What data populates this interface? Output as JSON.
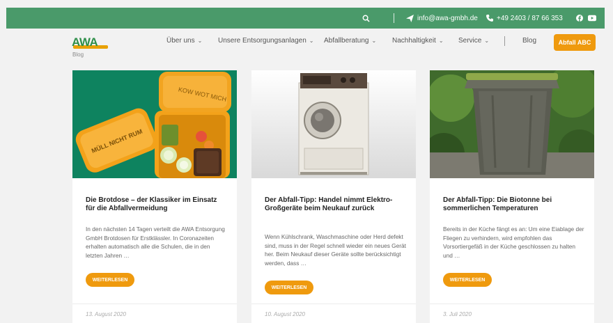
{
  "topbar": {
    "email": "info@awa-gmbh.de",
    "phone": "+49 2403 / 87 66 353",
    "icons": [
      "search-icon",
      "paper-plane-icon",
      "phone-icon",
      "facebook-icon",
      "youtube-icon"
    ],
    "color": "#4a9a6a"
  },
  "header": {
    "logo_text": "AWA",
    "nav": [
      {
        "label": "Über uns"
      },
      {
        "label": "Unsere Entsorgungsanlagen"
      },
      {
        "label": "Abfallberatung"
      },
      {
        "label": "Nachhaltigkeit"
      },
      {
        "label": "Service"
      },
      {
        "label": "Blog"
      }
    ],
    "cta_label": "Abfall ABC",
    "cta_color": "#ef9a0e"
  },
  "breadcrumb": "Blog",
  "cards": [
    {
      "title": "Die Brotdose – der Klassiker im Einsatz für die Abfallvermeidung",
      "excerpt": "In den nächsten 14 Tagen verteilt die AWA Entsorgung GmbH Brotdosen für Erstklässler. In Coronazeiten erhalten automatisch alle die Schulen, die in den letzten Jahren …",
      "button": "WEITERLESEN",
      "date": "13. August 2020",
      "image_text_1": "MÜLL NICHT RUM",
      "image_text_2": "KOW WOT MICH"
    },
    {
      "title": "Der Abfall-Tipp: Handel nimmt Elektro-Großgeräte beim Neukauf zurück",
      "excerpt": "Wenn Kühlschrank, Waschmaschine oder Herd defekt sind, muss in der Regel schnell wieder ein neues Gerät her. Beim Neukauf dieser Geräte sollte berücksichtigt werden, dass …",
      "button": "WEITERLESEN",
      "date": "10. August 2020"
    },
    {
      "title": "Der Abfall-Tipp: Die Biotonne bei sommerlichen Temperaturen",
      "excerpt": "Bereits in der Küche fängt es an: Um eine Eiablage der Fliegen zu verhindern, wird empfohlen das Vorsortiergefäß in der Küche geschlossen zu halten und …",
      "button": "WEITERLESEN",
      "date": "3. Juli 2020"
    }
  ]
}
